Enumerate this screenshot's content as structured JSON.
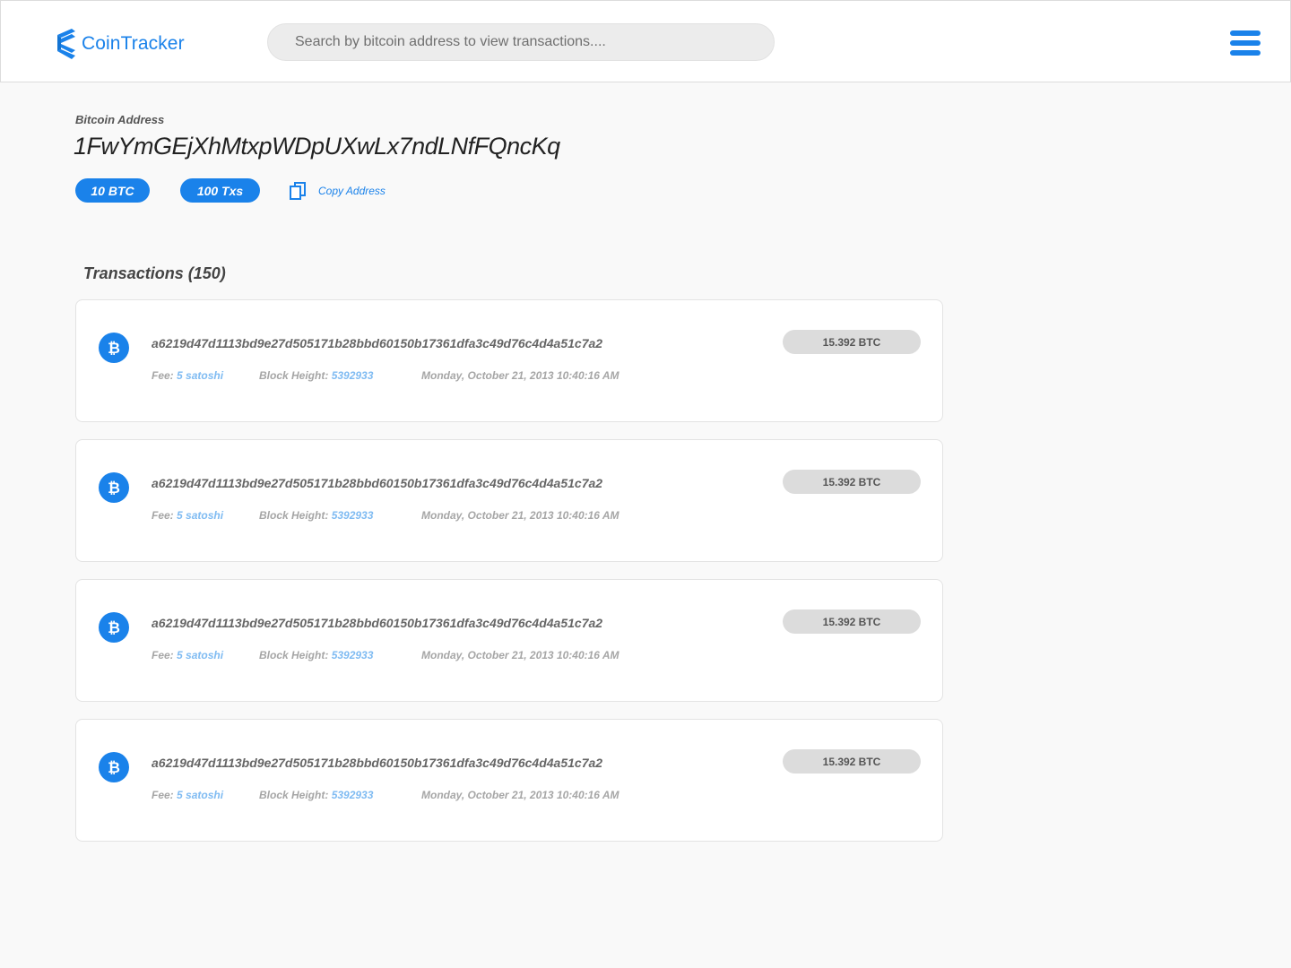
{
  "header": {
    "logo_text": "CoinTracker",
    "search_placeholder": "Search by bitcoin address to view transactions....",
    "brand_color": "#1a82ea"
  },
  "address": {
    "label": "Bitcoin Address",
    "value": "1FwYmGEjXhMtxpWDpUXwLx7ndLNfFQncKq",
    "balance_badge": "10 BTC",
    "tx_badge": "100 Txs",
    "copy_label": "Copy Address"
  },
  "transactions": {
    "heading": "Transactions (150)",
    "fee_label": "Fee:",
    "block_label": "Block Height:",
    "items": [
      {
        "hash": "a6219d47d1113bd9e27d505171b28bbd60150b17361dfa3c49d76c4d4a51c7a2",
        "fee": "5 satoshi",
        "block_height": "5392933",
        "date": "Monday, October 21, 2013 10:40:16 AM",
        "amount": "15.392 BTC"
      },
      {
        "hash": "a6219d47d1113bd9e27d505171b28bbd60150b17361dfa3c49d76c4d4a51c7a2",
        "fee": "5 satoshi",
        "block_height": "5392933",
        "date": "Monday, October 21, 2013 10:40:16 AM",
        "amount": "15.392 BTC"
      },
      {
        "hash": "a6219d47d1113bd9e27d505171b28bbd60150b17361dfa3c49d76c4d4a51c7a2",
        "fee": "5 satoshi",
        "block_height": "5392933",
        "date": "Monday, October 21, 2013 10:40:16 AM",
        "amount": "15.392 BTC"
      },
      {
        "hash": "a6219d47d1113bd9e27d505171b28bbd60150b17361dfa3c49d76c4d4a51c7a2",
        "fee": "5 satoshi",
        "block_height": "5392933",
        "date": "Monday, October 21, 2013 10:40:16 AM",
        "amount": "15.392 BTC"
      }
    ]
  }
}
